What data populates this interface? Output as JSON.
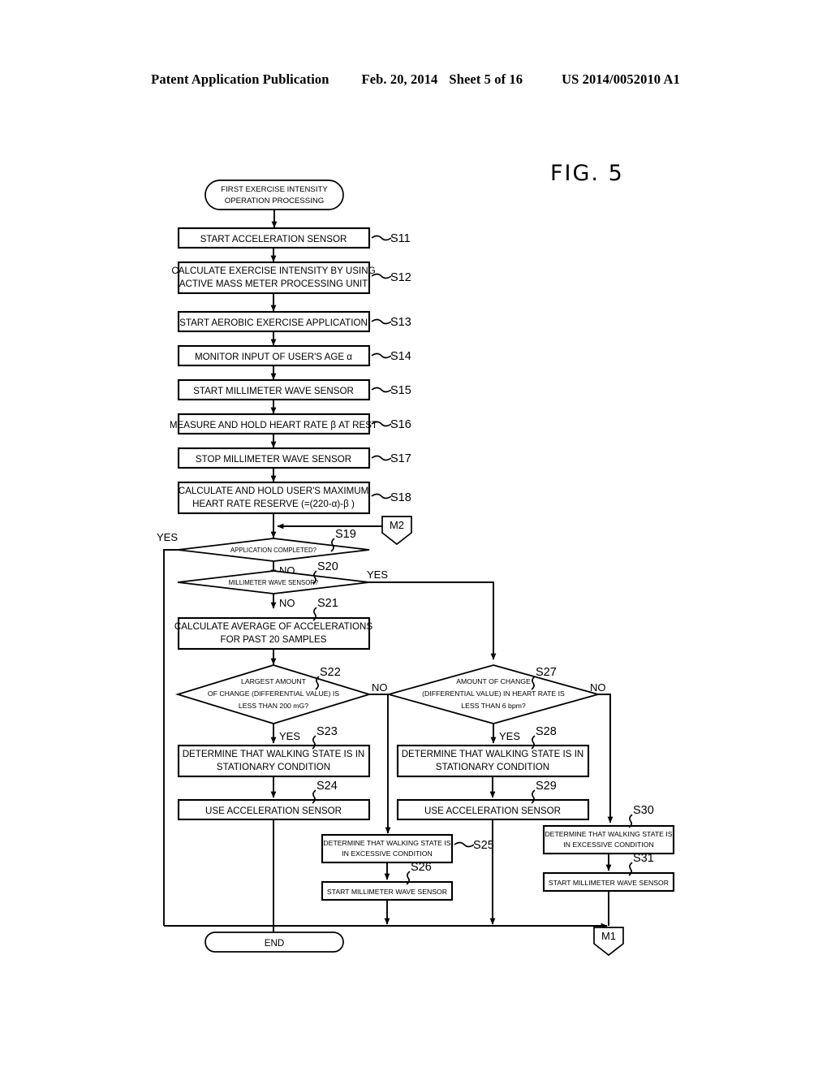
{
  "header": {
    "publication": "Patent Application Publication",
    "date": "Feb. 20, 2014",
    "sheet": "Sheet 5 of 16",
    "docnum": "US 2014/0052010 A1"
  },
  "figure": {
    "title": "FIG.  5"
  },
  "flowchart": {
    "start": {
      "line1": "FIRST EXERCISE INTENSITY",
      "line2": "OPERATION PROCESSING"
    },
    "end": {
      "label": "END"
    },
    "connectors": {
      "m1": "M1",
      "m2": "M2"
    },
    "branch_labels": {
      "yes": "YES",
      "no": "NO"
    },
    "steps": [
      {
        "id": "S11",
        "lines": [
          "START ACCELERATION SENSOR"
        ]
      },
      {
        "id": "S12",
        "lines": [
          "CALCULATE EXERCISE INTENSITY BY USING",
          "ACTIVE MASS METER PROCESSING UNIT"
        ]
      },
      {
        "id": "S13",
        "lines": [
          "START AEROBIC EXERCISE APPLICATION"
        ]
      },
      {
        "id": "S14",
        "lines": [
          "MONITOR INPUT OF USER'S AGE  α"
        ]
      },
      {
        "id": "S15",
        "lines": [
          "START MILLIMETER WAVE SENSOR"
        ]
      },
      {
        "id": "S16",
        "lines": [
          "MEASURE AND HOLD HEART RATE  β AT REST"
        ]
      },
      {
        "id": "S17",
        "lines": [
          "STOP MILLIMETER WAVE SENSOR"
        ]
      },
      {
        "id": "S18",
        "lines": [
          "CALCULATE AND HOLD USER'S MAXIMUM",
          "HEART RATE RESERVE  (=(220-α)-β )"
        ]
      },
      {
        "id": "S19",
        "lines": [
          "APPLICATION COMPLETED?"
        ]
      },
      {
        "id": "S20",
        "lines": [
          "MILLIMETER WAVE SENSOR?"
        ]
      },
      {
        "id": "S21",
        "lines": [
          "CALCULATE AVERAGE OF ACCELERATIONS",
          "FOR PAST 20 SAMPLES"
        ]
      },
      {
        "id": "S22",
        "lines": [
          "LARGEST AMOUNT",
          "OF CHANGE (DIFFERENTIAL VALUE) IS",
          "LESS THAN 200 mG?"
        ]
      },
      {
        "id": "S23",
        "lines": [
          "DETERMINE THAT WALKING STATE IS IN",
          "STATIONARY CONDITION"
        ]
      },
      {
        "id": "S24",
        "lines": [
          "USE ACCELERATION SENSOR"
        ]
      },
      {
        "id": "S25",
        "lines": [
          "DETERMINE THAT WALKING STATE IS",
          "IN EXCESSIVE CONDITION"
        ]
      },
      {
        "id": "S26",
        "lines": [
          "START MILLIMETER WAVE SENSOR"
        ]
      },
      {
        "id": "S27",
        "lines": [
          "AMOUNT OF CHANGE",
          "(DIFFERENTIAL VALUE) IN HEART RATE IS",
          "LESS THAN 6 bpm?"
        ]
      },
      {
        "id": "S28",
        "lines": [
          "DETERMINE THAT WALKING STATE IS IN",
          "STATIONARY CONDITION"
        ]
      },
      {
        "id": "S29",
        "lines": [
          "USE ACCELERATION SENSOR"
        ]
      },
      {
        "id": "S30",
        "lines": [
          "DETERMINE THAT WALKING STATE IS",
          "IN EXCESSIVE CONDITION"
        ]
      },
      {
        "id": "S31",
        "lines": [
          "START MILLIMETER WAVE SENSOR"
        ]
      }
    ]
  }
}
